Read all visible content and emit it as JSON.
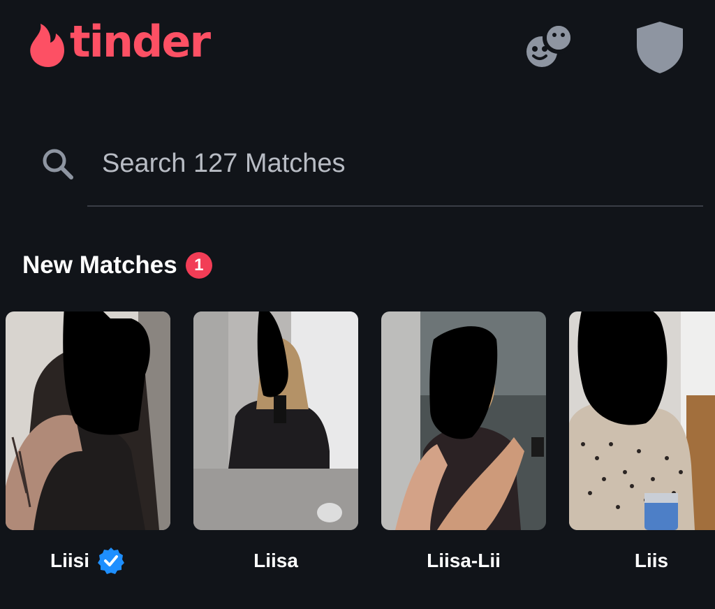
{
  "app": {
    "brand": "tinder",
    "brand_color": "#fd5064"
  },
  "header": {
    "icons": [
      "tinder-flame-icon",
      "chat-bubbles-icon",
      "shield-icon"
    ]
  },
  "search": {
    "placeholder": "Search 127 Matches",
    "icon": "search-icon"
  },
  "new_matches": {
    "title": "New Matches",
    "badge_count": "1",
    "badge_color": "#f23d56",
    "items": [
      {
        "name": "Liisi",
        "verified": true
      },
      {
        "name": "Liisa",
        "verified": false
      },
      {
        "name": "Liisa-Lii",
        "verified": false
      },
      {
        "name": "Liis",
        "verified": false
      }
    ]
  },
  "colors": {
    "background": "#111419",
    "icon_gray": "#8e95a1",
    "verified_blue": "#1e8fff"
  }
}
